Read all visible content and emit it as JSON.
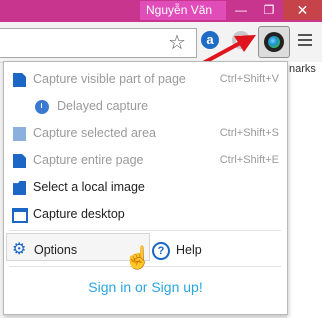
{
  "titlebar": {
    "user_name": "Nguyễn Văn",
    "minimize_glyph": "—",
    "maximize_glyph": "❐",
    "close_glyph": "✕"
  },
  "toolbar": {
    "star_icon": "star-icon",
    "extension_letter": "a",
    "bookmarks_partial": "narks"
  },
  "menu": {
    "items": [
      {
        "label": "Capture visible part of page",
        "shortcut": "Ctrl+Shift+V"
      },
      {
        "label": "Delayed capture",
        "shortcut": ""
      },
      {
        "label": "Capture selected area",
        "shortcut": "Ctrl+Shift+S"
      },
      {
        "label": "Capture entire page",
        "shortcut": "Ctrl+Shift+E"
      },
      {
        "label": "Select a local image",
        "shortcut": ""
      },
      {
        "label": "Capture desktop",
        "shortcut": ""
      }
    ],
    "options_label": "Options",
    "help_label": "Help",
    "signin_label": "Sign in or Sign up!"
  },
  "colors": {
    "titlebar": "#c7358f",
    "accent": "#1c66c5",
    "link": "#29a7e0",
    "arrow": "#e0141c"
  }
}
